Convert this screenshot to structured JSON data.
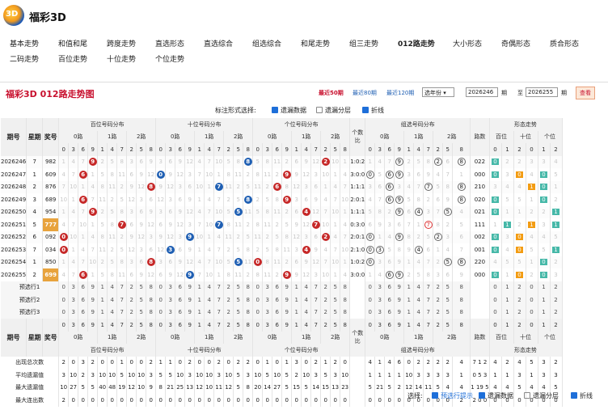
{
  "app": {
    "title": "福彩3D"
  },
  "nav": {
    "items": [
      {
        "label": "基本走势",
        "active": false
      },
      {
        "label": "和值和尾",
        "active": false
      },
      {
        "label": "跨度走势",
        "active": false
      },
      {
        "label": "直选形态",
        "active": false
      },
      {
        "label": "直选综合",
        "active": false
      },
      {
        "label": "组选综合",
        "active": false
      },
      {
        "label": "和尾走势",
        "active": false
      },
      {
        "label": "组三走势",
        "active": false
      },
      {
        "label": "012路走势",
        "active": true
      },
      {
        "label": "大小形态",
        "active": false
      },
      {
        "label": "奇偶形态",
        "active": false
      },
      {
        "label": "质合形态",
        "active": false
      },
      {
        "label": "二码走势",
        "active": false
      },
      {
        "label": "百位走势",
        "active": false
      },
      {
        "label": "十位走势",
        "active": false
      },
      {
        "label": "个位走势",
        "active": false
      }
    ]
  },
  "panel": {
    "title": "福彩3D 012路走势图",
    "ranges": [
      "最近50期",
      "最近80期",
      "最近120期"
    ],
    "selected_range": "最近50期",
    "period_select": "选年份",
    "from_value": "2026246",
    "to_label": "至",
    "to_value": "2026255",
    "unit_label": "期",
    "query_button": "查看"
  },
  "options": {
    "label": "标注形式选择:",
    "items": [
      {
        "label": "遗漏数据",
        "checked": true
      },
      {
        "label": "遗漏分层",
        "checked": false
      },
      {
        "label": "折线",
        "checked": true
      }
    ]
  },
  "table": {
    "headers": {
      "period": "期号",
      "weekday": "星期",
      "prize": "奖号",
      "bai": "百位号码分布",
      "shi": "十位号码分布",
      "ge": "个位号码分布",
      "count_ratio": "个数比",
      "group": "组选号码分布",
      "lushu": "路数",
      "shape": "形态走势",
      "road0": "0路",
      "road1": "1路",
      "road2": "2路",
      "pos": [
        "百位",
        "十位",
        "个位"
      ],
      "digits": [
        "0",
        "3",
        "6",
        "9",
        "1",
        "4",
        "7",
        "2",
        "5",
        "8"
      ],
      "roads": [
        "0",
        "1",
        "2"
      ]
    },
    "rows": [
      {
        "period": "2026246",
        "weekday": "7",
        "prize": "982",
        "ratio": "1:0:2",
        "lushu": "022"
      },
      {
        "period": "2026247",
        "weekday": "1",
        "prize": "609",
        "ratio": "3:0:0",
        "lushu": "000"
      },
      {
        "period": "2026248",
        "weekday": "2",
        "prize": "876",
        "ratio": "1:1:1",
        "lushu": "210"
      },
      {
        "period": "2026249",
        "weekday": "3",
        "prize": "689",
        "ratio": "2:0:1",
        "lushu": "020"
      },
      {
        "period": "2026250",
        "weekday": "4",
        "prize": "954",
        "ratio": "1:1:1",
        "lushu": "021"
      },
      {
        "period": "2026251",
        "weekday": "5",
        "prize": "777",
        "ratio": "0:3:0",
        "lushu": "111"
      },
      {
        "period": "2026252",
        "weekday": "6",
        "prize": "092",
        "ratio": "2:0:1",
        "lushu": "002"
      },
      {
        "period": "2026253",
        "weekday": "7",
        "prize": "034",
        "ratio": "2:1:0",
        "lushu": "001"
      },
      {
        "period": "2026254",
        "weekday": "1",
        "prize": "850",
        "ratio": "1:0:2",
        "lushu": "220"
      },
      {
        "period": "2026255",
        "weekday": "2",
        "prize": "699",
        "ratio": "3:0:0",
        "lushu": "000"
      }
    ],
    "predict_rows": [
      "预选行1",
      "预选行2",
      "预选行3"
    ],
    "stat_rows": [
      {
        "label": "出现总次数",
        "bai": "2 0 3 2 0 0 1 0 0 2",
        "shi": "1 1 0 2 0 0 2 0 2 2",
        "ge": "0 1 0 1 3 0 2 1 2 0",
        "group": "4 1 4 6 0 2 2 2 2 4",
        "lushu": "7 1 2",
        "shape": "4 2 4 5 3 2"
      },
      {
        "label": "平均遗漏值",
        "bai": "3 10 2 3 10 10 5 10 10 3",
        "shi": "5 5 10 3 10 10 3 10 5 3",
        "ge": "10 5 10 5 2 10 3 5 3 10",
        "group": "1 1 1 1 10 3 3 3 3 1",
        "lushu": "0 5 3",
        "shape": "1 1 3 1 3 3"
      },
      {
        "label": "最大遗漏值",
        "bai": "10 27 5 5 40 48 19 12 10 9",
        "shi": "8 21 25 13 12 10 11 12 5 8",
        "ge": "20 14 27 5 15 5 14 15 13 23",
        "group": "5 21 5 2 12 14 11 5 4 4",
        "lushu": "1 19 5",
        "shape": "4 4 5 4 4 5"
      },
      {
        "label": "最大连出数",
        "bai": "2 0 0 0 0 0 0 0 0 0",
        "shi": "0 0 0 0 0 0 0 0 0 0",
        "ge": "0 0 0 0 0 0 0 0 0 0",
        "group": "0 0 0 0 0 0 0 0 0 2",
        "lushu": "2 0 0",
        "shape": "0 0 0 0 0 0"
      }
    ]
  },
  "footer": {
    "label": "选择:",
    "items": [
      {
        "label": "预选行提示",
        "checked": true
      },
      {
        "label": "遗漏数据",
        "checked": true
      },
      {
        "label": "遗漏分层",
        "checked": false
      },
      {
        "label": "折线",
        "checked": true
      }
    ]
  },
  "colors": {
    "accent": "#c8102e",
    "ball_red": "#c62828",
    "ball_blue": "#1f5fb3",
    "highlight_orange": "#f39c12",
    "highlight_teal": "#46b8a8"
  }
}
